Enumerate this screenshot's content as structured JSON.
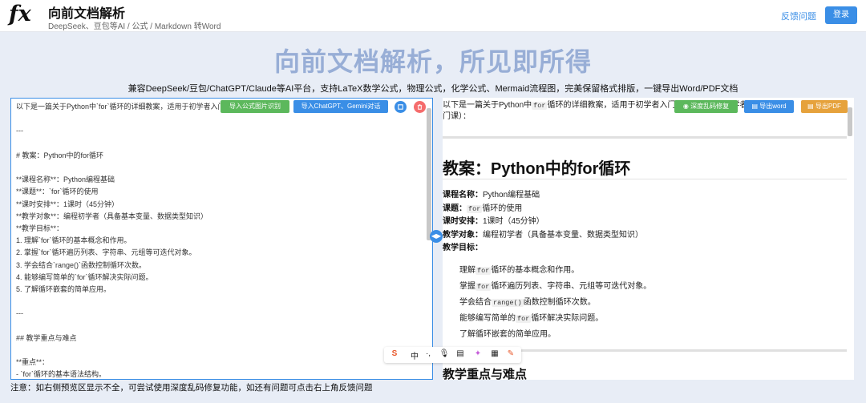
{
  "header": {
    "logo_text": "fx",
    "title": "向前文档解析",
    "subtitle": "DeepSeek、豆包等AI / 公式 / Markdown 转Word",
    "feedback_label": "反馈问题",
    "login_label": "登录"
  },
  "hero": {
    "title": "向前文档解析，所见即所得",
    "tagline": "兼容DeepSeek/豆包/ChatGPT/Claude等AI平台，支持LaTeX数学公式，物理公式，化学公式、Mermaid流程图，完美保留格式排版，一键导出Word/PDF文档"
  },
  "editor": {
    "text": "以下是一篇关于Python中`for`循环的详细教案，适用于初学者入门课\n\n---\n\n# 教案：Python中的for循环\n\n**课程名称**：Python编程基础\n**课题**：`for`循环的使用\n**课时安排**：1课时（45分钟）\n**教学对象**：编程初学者（具备基本变量、数据类型知识）\n**教学目标**：\n1. 理解`for`循环的基本概念和作用。\n2. 掌握`for`循环遍历列表、字符串、元组等可迭代对象。\n3. 学会结合`range()`函数控制循环次数。\n4. 能够编写简单的`for`循环解决实际问题。\n5. 了解循环嵌套的简单应用。\n\n---\n\n## 教学重点与难点\n\n**重点**：\n- `for`循环的基本语法结构。\n- 使用`range()`生成数字序列。\n- 遍历字符串和列表",
    "import_formula_label": "导入公式图片识别",
    "import_chat_label": "导入ChatGPT、Gemini对话",
    "copy_icon": "copy-icon",
    "delete_icon": "trash-icon"
  },
  "preview": {
    "intro_a": "以下是一篇关于Python中",
    "intro_code": "for",
    "intro_b": "循环的详细教案，适用于初学者入门课程（适用于初学者入门课",
    "intro_c": "门课）：",
    "h1": "教案：Python中的for循环",
    "meta": [
      {
        "label": "课程名称：",
        "value": "Python编程基础"
      },
      {
        "label": "课题：",
        "code": "for",
        "value": "循环的使用"
      },
      {
        "label": "课时安排：",
        "value": "1课时（45分钟）"
      },
      {
        "label": "教学对象：",
        "value": "编程初学者（具备基本变量、数据类型知识）"
      },
      {
        "label": "教学目标：",
        "value": ""
      }
    ],
    "goals": [
      {
        "pre": "理解",
        "code": "for",
        "post": "循环的基本概念和作用。"
      },
      {
        "pre": "掌握",
        "code": "for",
        "post": "循环遍历列表、字符串、元组等可迭代对象。"
      },
      {
        "pre": "学会结合",
        "code": "range()",
        "post": "函数控制循环次数。"
      },
      {
        "pre": "能够编写简单的",
        "code": "for",
        "post": "循环解决实际问题。"
      },
      {
        "pre": "了解循环嵌套的简单应用。",
        "code": "",
        "post": ""
      }
    ],
    "h2": "教学重点与难点",
    "fix_label": "深度乱码修复",
    "export_word_label": "导出word",
    "export_pdf_label": "导出PDF"
  },
  "ime": {
    "items": [
      "S",
      "中",
      "·,",
      "mic",
      "kbd",
      "skin",
      "grid",
      "tool"
    ]
  },
  "footer": {
    "note": "注意：如右侧预览区显示不全，可尝试使用深度乱码修复功能，如还有问题可点击右上角反馈问题"
  },
  "colors": {
    "accent": "#3a8ee6",
    "green": "#5cb85c",
    "orange": "#e6a23c",
    "hero": "#98aed6"
  }
}
